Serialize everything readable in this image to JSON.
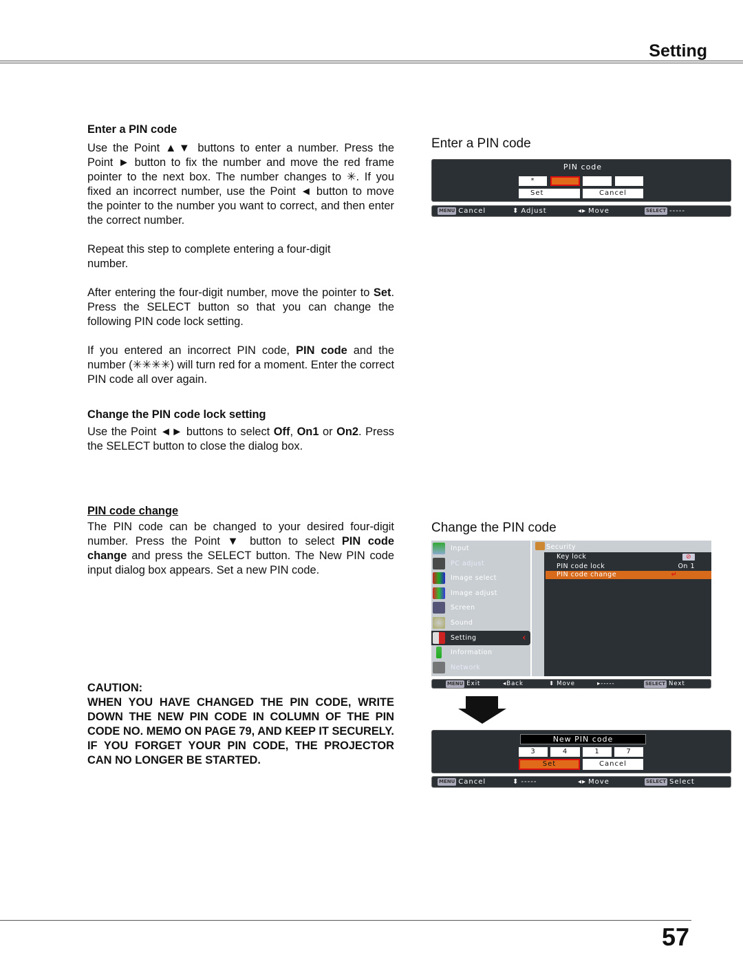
{
  "header": {
    "section": "Setting"
  },
  "footer": {
    "page_number": "57"
  },
  "left": {
    "enter_pin": {
      "heading": "Enter a PIN code",
      "p1": "Use the Point ▲▼  buttons to enter a number. Press the Point ► button to fix the number and move the red frame pointer to the next box. The number changes to ✳. If you fixed an incorrect number, use the Point ◄ button to move the pointer to the number you want to correct, and then enter the correct number.",
      "p2": "Repeat this step to complete entering a four-digit number.",
      "p3_a": "After entering the four-digit number, move the pointer to ",
      "p3_b": "Set",
      "p3_c": ". Press the SELECT button so that you can change the following PIN code lock setting.",
      "p4_a": "If you entered an incorrect PIN code, ",
      "p4_b": "PIN code",
      "p4_c": " and the number (✳✳✳✳) will turn red for a moment. Enter the correct PIN code all over again."
    },
    "change_lock": {
      "heading": "Change the PIN code lock setting",
      "p_a": "Use the Point ◄► buttons to select ",
      "off": "Off",
      "sep1": ", ",
      "on1": "On1",
      "sep2": " or ",
      "on2": "On2",
      "p_b": ". Press the SELECT button to close the dialog box."
    },
    "pin_change": {
      "heading": "PIN code change ",
      "p_a": "The PIN code can be changed to your desired four-digit number. Press the Point ▼ button to select ",
      "p_b": "PIN code change",
      "p_c": " and press the SELECT button. The New PIN code input dialog box appears. Set a new PIN code."
    },
    "caution": {
      "heading": "CAUTION:",
      "text": "WHEN YOU HAVE CHANGED THE PIN CODE, WRITE DOWN THE NEW PIN CODE IN COLUMN OF THE PIN CODE NO. MEMO ON PAGE 79, AND KEEP IT SECURELY. IF YOU FORGET YOUR PIN CODE, THE PROJECTOR CAN NO LONGER BE STARTED."
    }
  },
  "fig1": {
    "title": "Enter a PIN code",
    "dialog_title": "PIN code",
    "digits": [
      "*",
      "",
      "",
      ""
    ],
    "selected_index": 1,
    "set_label": "Set",
    "cancel_label": "Cancel",
    "bar": {
      "menu_key": "MENU",
      "menu_action": "Cancel",
      "updown_action": "Adjust",
      "leftright_action": "Move",
      "select_key": "SELECT",
      "select_action": "-----"
    }
  },
  "fig2": {
    "title": "Change the PIN code",
    "menu_items": [
      {
        "label": "Input",
        "icon": "input-icon"
      },
      {
        "label": "PC adjust",
        "icon": "pc-adjust-icon"
      },
      {
        "label": "Image select",
        "icon": "image-select-icon"
      },
      {
        "label": "Image adjust",
        "icon": "image-adjust-icon"
      },
      {
        "label": "Screen",
        "icon": "screen-icon"
      },
      {
        "label": "Sound",
        "icon": "sound-icon"
      },
      {
        "label": "Setting",
        "icon": "setting-icon"
      },
      {
        "label": "Information",
        "icon": "information-icon"
      },
      {
        "label": "Network",
        "icon": "network-icon"
      }
    ],
    "active_menu": "Setting",
    "submenu_title": "Security",
    "sub_items": [
      {
        "label": "Key lock",
        "value": ""
      },
      {
        "label": "PIN code lock",
        "value": "On 1"
      },
      {
        "label": "PIN code change",
        "value": "↵"
      }
    ],
    "bar": {
      "menu_key": "MENU",
      "menu_action": "Exit",
      "back_action": "◂Back",
      "updown_action": "Move",
      "right_action": "▸-----",
      "select_key": "SELECT",
      "select_action": "Next"
    }
  },
  "fig3": {
    "dialog_title": "New PIN code",
    "digits": [
      "3",
      "4",
      "1",
      "7"
    ],
    "set_label": "Set",
    "cancel_label": "Cancel",
    "bar": {
      "menu_key": "MENU",
      "menu_action": "Cancel",
      "updown_action": "-----",
      "leftright_action": "Move",
      "select_key": "SELECT",
      "select_action": "Select"
    }
  }
}
